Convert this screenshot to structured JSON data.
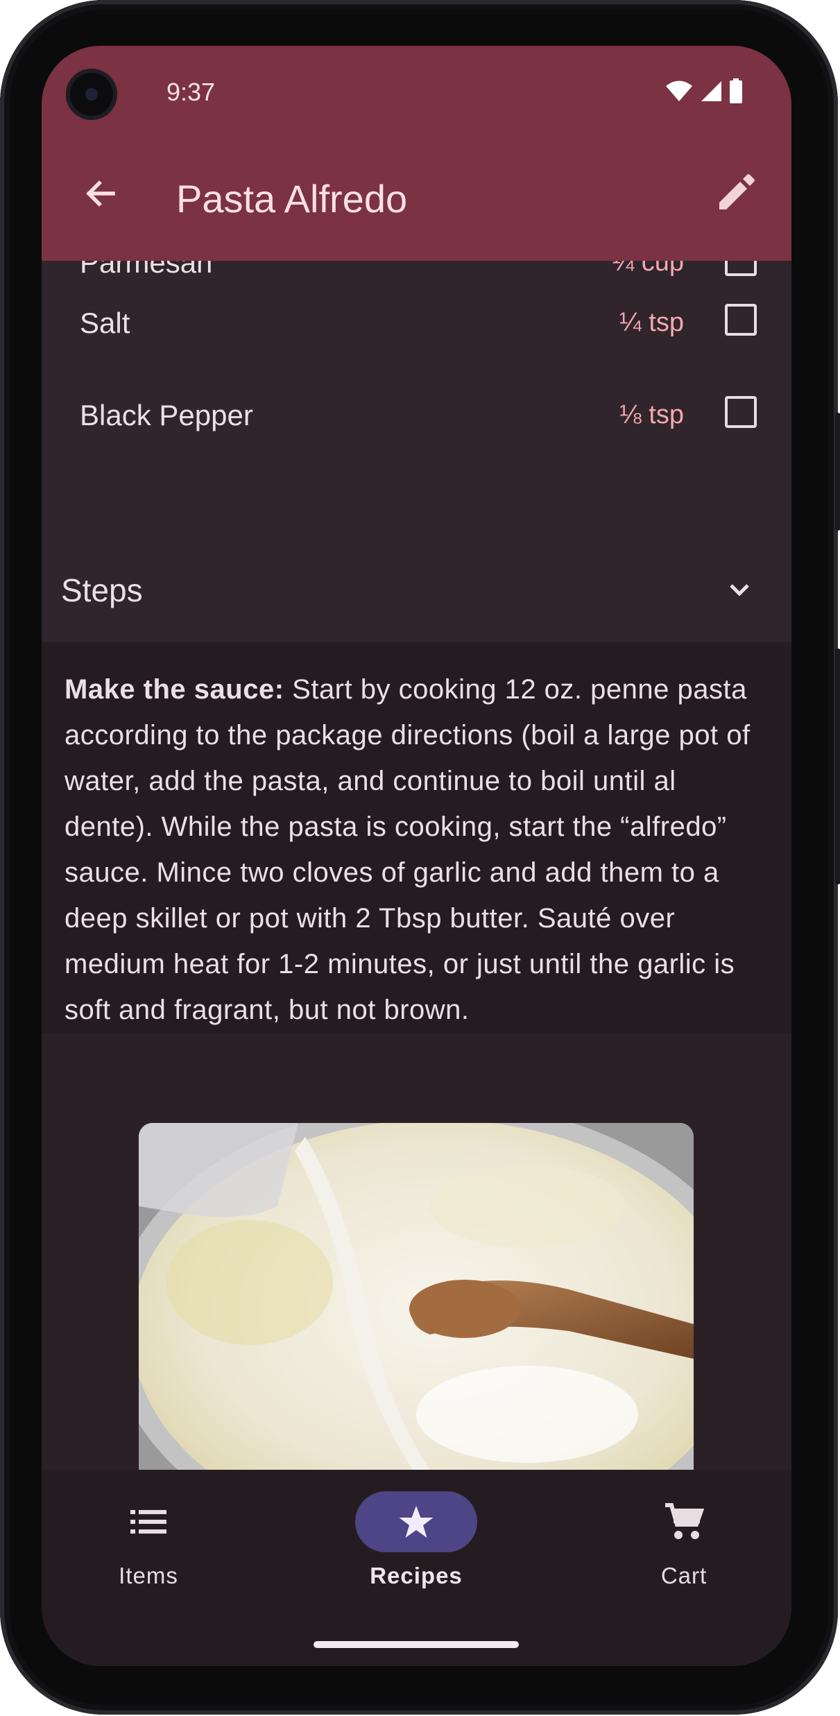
{
  "status_bar": {
    "time": "9:37"
  },
  "app_bar": {
    "title": "Pasta Alfredo"
  },
  "ingredients": [
    {
      "name": "Parmesan",
      "quantity": "¼ cup",
      "checked": false
    },
    {
      "name": "Salt",
      "quantity": "¼ tsp",
      "checked": false
    },
    {
      "name": "Black Pepper",
      "quantity": "⅛ tsp",
      "checked": false
    }
  ],
  "steps": {
    "header": "Steps",
    "step1_bold": "Make the sauce:",
    "step1_text": " Start by cooking 12 oz. penne pasta according to the package directions (boil a large pot of water, add the pasta, and continue to boil until al dente). While the pasta is cooking, start the “alfredo” sauce. Mince two cloves of garlic and add them to a deep skillet or pot with 2 Tbsp butter. Sauté over medium heat for 1-2 minutes, or just until the garlic is soft and fragrant, but not brown."
  },
  "bottom_nav": {
    "items": [
      {
        "label": "Items",
        "icon": "list-icon"
      },
      {
        "label": "Recipes",
        "icon": "star-icon",
        "active": true
      },
      {
        "label": "Cart",
        "icon": "cart-icon"
      }
    ]
  },
  "colors": {
    "app_bar": "#7b3242",
    "surface": "#2f252b",
    "background": "#251c22",
    "accent_text": "#f4a7b3",
    "nav_active": "#4d4586"
  }
}
